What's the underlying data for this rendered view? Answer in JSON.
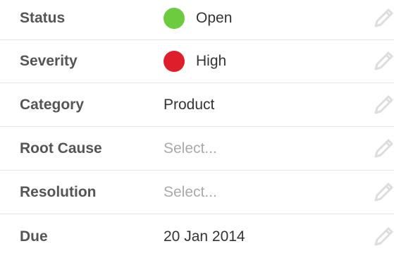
{
  "fields": [
    {
      "label": "Status",
      "value": "Open",
      "indicator": "green-dot",
      "color": "#6ccb3f",
      "placeholder": false
    },
    {
      "label": "Severity",
      "value": "High",
      "indicator": "red-dot",
      "color": "#de1e2a",
      "placeholder": false
    },
    {
      "label": "Category",
      "value": "Product",
      "placeholder": false
    },
    {
      "label": "Root Cause",
      "value": "Select...",
      "placeholder": true
    },
    {
      "label": "Resolution",
      "value": "Select...",
      "placeholder": true
    },
    {
      "label": "Due",
      "value": "20 Jan 2014",
      "placeholder": false
    }
  ],
  "icons": {
    "edit": "pencil-icon"
  },
  "colors": {
    "label": "#555555",
    "value": "#333333",
    "placeholder": "#aaaaaa",
    "divider": "#e4e4e4",
    "pencil": "#dddddd"
  }
}
